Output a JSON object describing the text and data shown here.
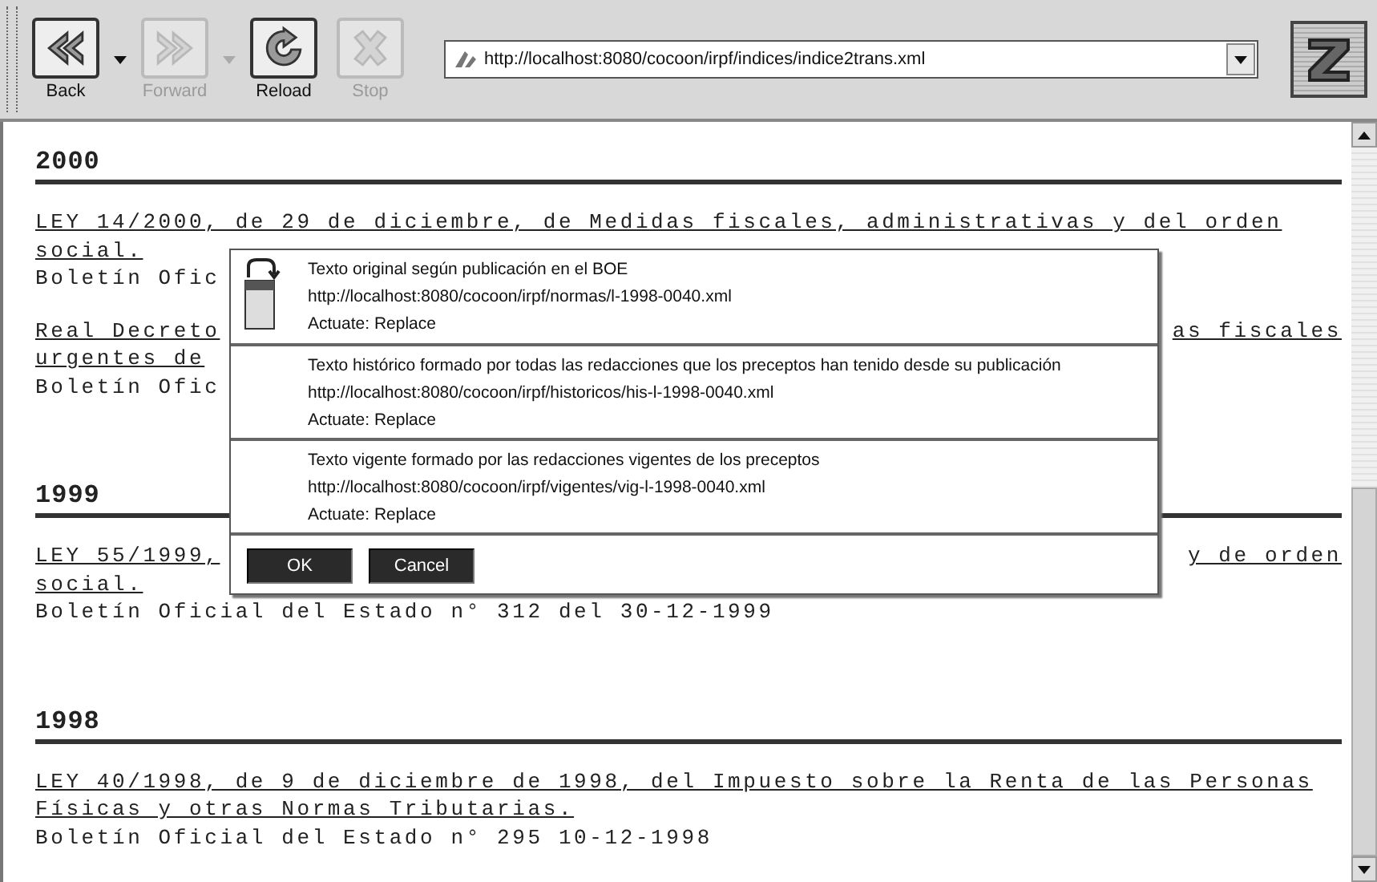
{
  "toolbar": {
    "buttons": [
      {
        "kind": "back",
        "label": "Back",
        "disabled": false,
        "menu": true
      },
      {
        "kind": "forward",
        "label": "Forward",
        "disabled": true,
        "menu": true
      },
      {
        "kind": "reload",
        "label": "Reload",
        "disabled": false,
        "menu": false
      },
      {
        "kind": "stop",
        "label": "Stop",
        "disabled": true,
        "menu": false
      }
    ],
    "address": {
      "value": "http://localhost:8080/cocoon/irpf/indices/indice2trans.xml"
    }
  },
  "sections": [
    {
      "year": "2000",
      "entries": [
        {
          "lines": [
            {
              "kind": "link",
              "text": "LEY 14/2000, de 29 de diciembre, de Medidas fiscales, administrativas y del orden"
            },
            {
              "kind": "link",
              "text": "social."
            },
            {
              "kind": "plain",
              "text": "Boletín Ofic"
            }
          ]
        },
        {
          "lines": [
            {
              "kind": "link",
              "text": "Real Decreto",
              "text_right": "as fiscales"
            },
            {
              "kind": "link",
              "text": "urgentes de"
            },
            {
              "kind": "plain",
              "text": "Boletín Ofic"
            }
          ]
        }
      ]
    },
    {
      "year": "1999",
      "entries": [
        {
          "lines": [
            {
              "kind": "link",
              "text": "LEY 55/1999,",
              "text_right": "y de orden"
            },
            {
              "kind": "link",
              "text": "social."
            },
            {
              "kind": "plain",
              "text": "Boletín Oficial del Estado n° 312 del 30-12-1999"
            }
          ]
        }
      ]
    },
    {
      "year": "1998",
      "entries": [
        {
          "lines": [
            {
              "kind": "link",
              "text": "LEY 40/1998, de 9 de diciembre de 1998, del Impuesto sobre la Renta de las Personas"
            },
            {
              "kind": "link",
              "text": "Físicas y otras Normas Tributarias."
            },
            {
              "kind": "plain",
              "text": "Boletín Oficial del Estado n° 295 10-12-1998"
            }
          ]
        }
      ]
    }
  ],
  "popup": {
    "items": [
      {
        "title": "Texto original según publicación en el BOE",
        "url": "http://localhost:8080/cocoon/irpf/normas/l-1998-0040.xml",
        "actuate": "Actuate: Replace",
        "icon": true
      },
      {
        "title": "Texto histórico formado por todas las redacciones que los preceptos han tenido desde su publicación",
        "url": "http://localhost:8080/cocoon/irpf/historicos/his-l-1998-0040.xml",
        "actuate": "Actuate: Replace",
        "icon": false
      },
      {
        "title": "Texto vigente formado por las redacciones vigentes de los preceptos",
        "url": "http://localhost:8080/cocoon/irpf/vigentes/vig-l-1998-0040.xml",
        "actuate": "Actuate: Replace",
        "icon": false
      }
    ],
    "buttons": [
      "OK",
      "Cancel"
    ]
  }
}
